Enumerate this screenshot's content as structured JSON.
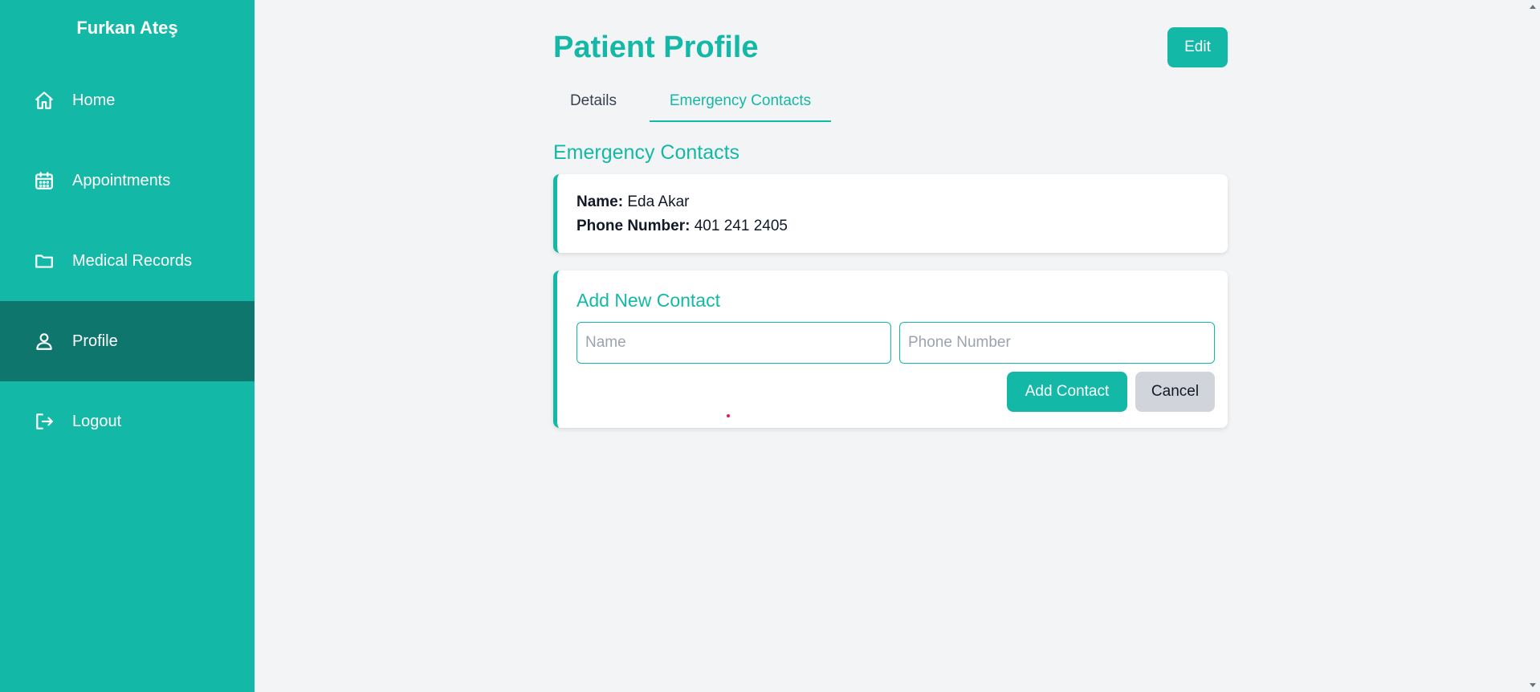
{
  "sidebar": {
    "user_name": "Furkan Ateş",
    "items": [
      {
        "label": "Home",
        "icon": "home-icon"
      },
      {
        "label": "Appointments",
        "icon": "calendar-icon"
      },
      {
        "label": "Medical Records",
        "icon": "folder-icon"
      },
      {
        "label": "Profile",
        "icon": "user-icon",
        "active": true
      },
      {
        "label": "Logout",
        "icon": "logout-icon"
      }
    ]
  },
  "header": {
    "title": "Patient Profile",
    "edit_label": "Edit"
  },
  "tabs": [
    {
      "label": "Details",
      "active": false
    },
    {
      "label": "Emergency Contacts",
      "active": true
    }
  ],
  "emergency": {
    "section_title": "Emergency Contacts",
    "contacts": [
      {
        "name_label": "Name:",
        "name": "Eda Akar",
        "phone_label": "Phone Number:",
        "phone": "401 241 2405"
      }
    ]
  },
  "add_contact": {
    "title": "Add New Contact",
    "name_placeholder": "Name",
    "phone_placeholder": "Phone Number",
    "add_label": "Add Contact",
    "cancel_label": "Cancel"
  },
  "colors": {
    "accent": "#14b8a6",
    "sidebar_active": "#0f766e",
    "cancel_bg": "#d1d5db"
  }
}
